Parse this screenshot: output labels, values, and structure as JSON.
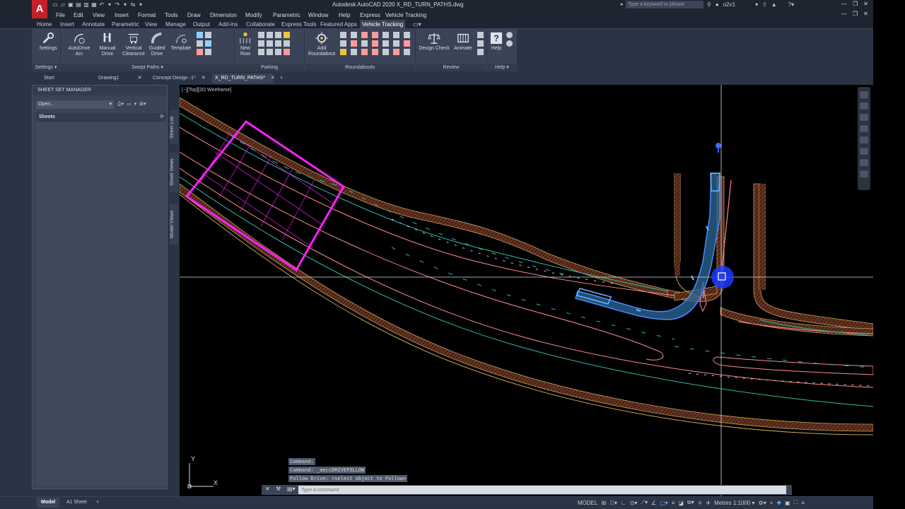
{
  "app": {
    "logo": "A",
    "title": "Autodesk AutoCAD 2020    X_RD_TURN_PATHS.dwg",
    "search_placeholder": "Type a keyword or phrase",
    "user": "o2v1"
  },
  "menu": [
    "File",
    "Edit",
    "View",
    "Insert",
    "Format",
    "Tools",
    "Draw",
    "Dimension",
    "Modify",
    "Parametric",
    "Window",
    "Help",
    "Express",
    "Vehicle Tracking"
  ],
  "ribbon_tabs": [
    "Home",
    "Insert",
    "Annotate",
    "Parametric",
    "View",
    "Manage",
    "Output",
    "Add-ins",
    "Collaborate",
    "Express Tools",
    "Featured Apps",
    "Vehicle Tracking"
  ],
  "ribbon": {
    "settings": {
      "button": "Settings",
      "footer": "Settings ▾"
    },
    "swept_paths": {
      "autodrive": [
        "AutoDrive",
        "Arc"
      ],
      "manual": [
        "Manual",
        "Drive"
      ],
      "vertical": [
        "Vertical",
        "Clearance"
      ],
      "guided": [
        "Guided",
        "Drive"
      ],
      "template": "Template",
      "footer": "Swept Paths ▾"
    },
    "parking": {
      "new_row": [
        "New",
        "Row"
      ],
      "footer": "Parking"
    },
    "roundabouts": {
      "add": [
        "Add",
        "Roundabout"
      ],
      "footer": "Roundabouts"
    },
    "review": {
      "design_check": "Design Check",
      "animate": "Animate",
      "footer": "Review"
    },
    "help": {
      "button": "Help",
      "footer": "Help ▾"
    }
  },
  "doc_tabs": [
    "Start",
    "Drawing1",
    "Concept Design -1*",
    "X_RD_TURN_PATHS*"
  ],
  "sheet_set_manager": {
    "title": "SHEET SET MANAGER",
    "open_value": "Open...",
    "sheets_header": "Sheets",
    "side_tabs": [
      "Sheet List",
      "Sheet Views",
      "Model Views"
    ]
  },
  "viewport": {
    "label": "[−][Top][2D Wireframe]",
    "ucs_x": "X",
    "ucs_y": "Y"
  },
  "command": {
    "history": [
      "Command:",
      "Command: _aeccDRIVEFOLLOW",
      "Follow Drive: <select object to Follow>"
    ],
    "placeholder": "Type a command"
  },
  "layout_tabs": [
    "Model",
    "A1 Sheet"
  ],
  "status": {
    "model": "MODEL",
    "scale": "Metres 1:1000 ▾"
  },
  "colors": {
    "road_edge": "#c8a050",
    "kerb_hatch": "#7a3a2a",
    "lane_line": "#ff8a8a",
    "center_line": "#2fb8a8",
    "crossing": "#ff20ff",
    "swept_path": "#3aa0ff"
  }
}
